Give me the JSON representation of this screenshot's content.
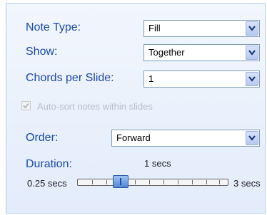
{
  "fields": {
    "note_type": {
      "label": "Note Type:",
      "value": "Fill"
    },
    "show": {
      "label": "Show:",
      "value": "Together"
    },
    "chords_per_slide": {
      "label": "Chords per Slide:",
      "value": "1"
    },
    "order": {
      "label": "Order:",
      "value": "Forward"
    }
  },
  "checkbox": {
    "label": "Auto-sort notes within slides",
    "checked": true,
    "enabled": false
  },
  "duration": {
    "label": "Duration:",
    "current": "1 secs",
    "min_label": "0.25 secs",
    "max_label": "3 secs",
    "value_fraction": 0.27
  },
  "icons": {
    "dropdown": "chevron-down-icon",
    "check": "check-icon"
  },
  "colors": {
    "label_text": "#1a4aa8",
    "panel_bg": "#e3ecfb",
    "thumb": "#4f86d6"
  }
}
